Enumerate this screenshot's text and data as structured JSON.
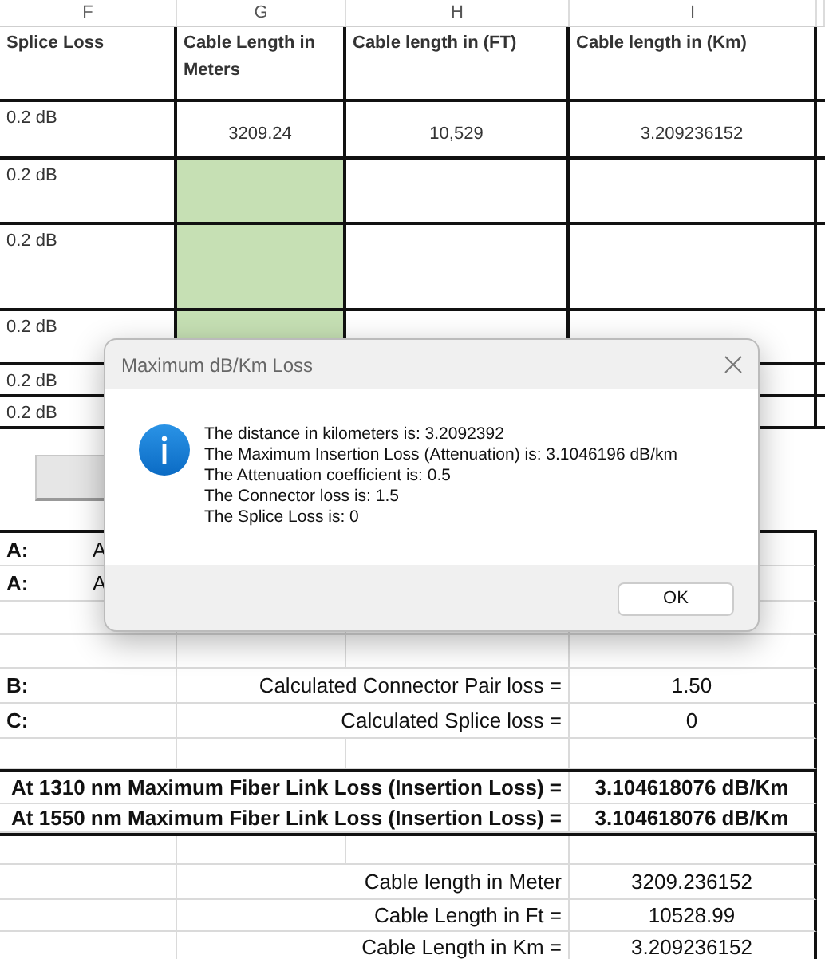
{
  "column_headers": [
    "F",
    "G",
    "H",
    "I"
  ],
  "table": {
    "columns": [
      "Splice Loss",
      "Cable Length in Meters",
      "Cable length in (FT)",
      "Cable length in (Km)"
    ],
    "rows": [
      {
        "splice_loss": "0.2 dB",
        "meters": "3209.24",
        "feet": "10,529",
        "km": "3.209236152",
        "highlighted": false
      },
      {
        "splice_loss": "0.2 dB",
        "highlighted": true
      },
      {
        "splice_loss": "0.2 dB",
        "highlighted": true
      },
      {
        "splice_loss": "0.2 dB",
        "highlighted": true
      },
      {
        "splice_loss": "0.2 dB"
      },
      {
        "splice_loss": "0.2 dB"
      }
    ]
  },
  "summary": {
    "rows": [
      {
        "kind": "label",
        "label": "A:",
        "text": "A"
      },
      {
        "kind": "label",
        "label": "A:",
        "text": "A"
      },
      {
        "kind": "blank"
      },
      {
        "kind": "blank"
      },
      {
        "kind": "calc",
        "label": "B:",
        "caption": "Calculated Connector Pair loss =",
        "value": "1.50"
      },
      {
        "kind": "calc",
        "label": "C:",
        "caption": "Calculated Splice loss =",
        "value": "0"
      },
      {
        "kind": "blank"
      },
      {
        "kind": "result",
        "caption": "At 1310 nm Maximum Fiber Link Loss (Insertion Loss) =",
        "value": "3.104618076 dB/Km"
      },
      {
        "kind": "result",
        "caption": "At 1550 nm Maximum Fiber Link Loss (Insertion Loss) =",
        "value": "3.104618076 dB/Km"
      },
      {
        "kind": "blank"
      },
      {
        "kind": "length",
        "caption": "Cable length in Meter",
        "value": "3209.236152"
      },
      {
        "kind": "length",
        "caption": "Cable Length in Ft =",
        "value": "10528.99"
      },
      {
        "kind": "length",
        "caption": "Cable Length in Km =",
        "value": "3.209236152"
      }
    ]
  },
  "dialog": {
    "title": "Maximum dB/Km Loss",
    "lines": [
      "The distance in kilometers is: 3.2092392",
      "The Maximum Insertion Loss (Attenuation) is: 3.1046196 dB/km",
      "The Attenuation coefficient is: 0.5",
      "The Connector loss is: 1.5",
      "The Splice Loss is: 0"
    ],
    "button": "OK"
  }
}
